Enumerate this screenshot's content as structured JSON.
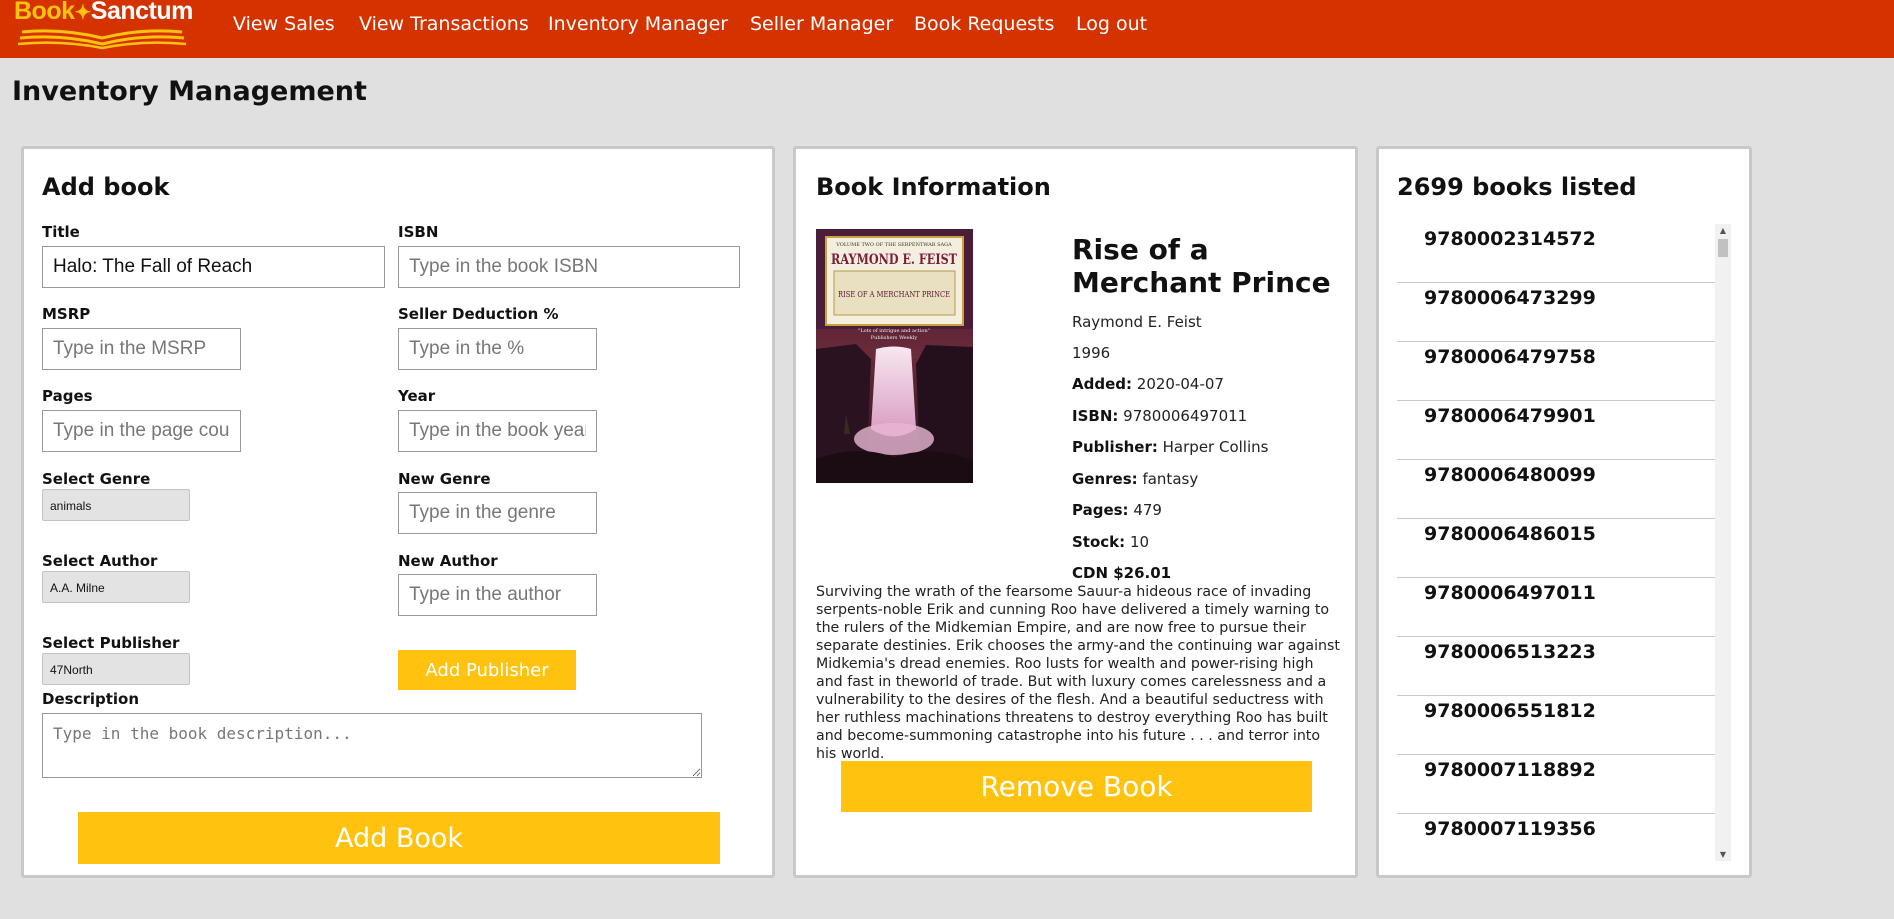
{
  "brand": {
    "part1": "Book",
    "part2": "Sanctum"
  },
  "nav": {
    "items": [
      {
        "label": "View Sales"
      },
      {
        "label": "View Transactions"
      },
      {
        "label": "Inventory Manager"
      },
      {
        "label": "Seller Manager"
      },
      {
        "label": "Book Requests"
      },
      {
        "label": "Log out"
      }
    ]
  },
  "page_title": "Inventory Management",
  "add_book": {
    "title": "Add book",
    "fields": {
      "title": {
        "label": "Title",
        "value": "Halo: The Fall of Reach"
      },
      "isbn": {
        "label": "ISBN",
        "placeholder": "Type in the book ISBN"
      },
      "msrp": {
        "label": "MSRP",
        "placeholder": "Type in the MSRP"
      },
      "seller_deduction": {
        "label": "Seller Deduction %",
        "placeholder": "Type in the %"
      },
      "pages": {
        "label": "Pages",
        "placeholder": "Type in the page count"
      },
      "year": {
        "label": "Year",
        "placeholder": "Type in the book year"
      },
      "select_genre": {
        "label": "Select Genre",
        "value": "animals"
      },
      "new_genre": {
        "label": "New Genre",
        "placeholder": "Type in the genre"
      },
      "select_author": {
        "label": "Select Author",
        "value": "A.A. Milne"
      },
      "new_author": {
        "label": "New Author",
        "placeholder": "Type in the author"
      },
      "select_publisher": {
        "label": "Select Publisher",
        "value": "47North"
      },
      "description": {
        "label": "Description",
        "placeholder": "Type in the book description..."
      }
    },
    "add_publisher_label": "Add Publisher",
    "add_book_label": "Add Book"
  },
  "book_info": {
    "heading": "Book Information",
    "cover": {
      "series": "VOLUME TWO OF THE SERPENTWAR SAGA",
      "author": "RAYMOND E. FEIST",
      "title": "RISE OF A MERCHANT PRINCE",
      "blurb": "\"Lots of intrigue and action\"",
      "source": "Publishers Weekly"
    },
    "title": "Rise of a Merchant Prince",
    "author": "Raymond E. Feist",
    "year": "1996",
    "added_label": "Added:",
    "added": "2020-04-07",
    "isbn_label": "ISBN:",
    "isbn": "9780006497011",
    "publisher_label": "Publisher:",
    "publisher": "Harper Collins",
    "genres_label": "Genres:",
    "genres": "fantasy",
    "pages_label": "Pages:",
    "pages": "479",
    "stock_label": "Stock:",
    "stock": "10",
    "price": "CDN $26.01",
    "description": "Surviving the wrath of the fearsome Sauur-a hideous race of invading serpents-noble Erik and cunning Roo have delivered a timely warning to the rulers of the Midkemian Empire, and are now free to pursue their separate destinies. Erik chooses the army-and the continuing war against Midkemia's dread enemies. Roo lusts for wealth and power-rising high and fast in theworld of trade. But with luxury comes carelessness and a vulnerability to the desires of the flesh. And a beautiful seductress with her ruthless machinations threatens to destroy everything Roo has built and become-summoning catastrophe into his future . . . and terror into his world.",
    "remove_label": "Remove Book"
  },
  "listing": {
    "count_title": "2699 books listed",
    "isbns": [
      "9780002314572",
      "9780006473299",
      "9780006479758",
      "9780006479901",
      "9780006480099",
      "9780006486015",
      "9780006497011",
      "9780006513223",
      "9780006551812",
      "9780007118892",
      "9780007119356"
    ]
  },
  "colors": {
    "nav_bg": "#d43300",
    "accent": "#ffc20e",
    "page_bg": "#e0e0e0"
  }
}
